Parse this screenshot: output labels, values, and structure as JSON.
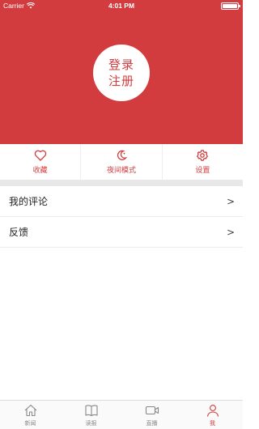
{
  "status_bar": {
    "carrier": "Carrier",
    "time": "4:01 PM"
  },
  "profile": {
    "login_line1": "登录",
    "login_line2": "注册"
  },
  "quick_actions": [
    {
      "label": "收藏",
      "icon": "heart-icon"
    },
    {
      "label": "夜间模式",
      "icon": "moon-icon"
    },
    {
      "label": "设置",
      "icon": "gear-icon"
    }
  ],
  "menu": [
    {
      "label": "我的评论",
      "chevron": ">"
    },
    {
      "label": "反馈",
      "chevron": ">"
    }
  ],
  "tabs": [
    {
      "label": "新闻",
      "icon": "home-icon",
      "active": false
    },
    {
      "label": "读报",
      "icon": "book-icon",
      "active": false
    },
    {
      "label": "直播",
      "icon": "video-camera-icon",
      "active": false
    },
    {
      "label": "我",
      "icon": "person-icon",
      "active": true
    }
  ],
  "colors": {
    "accent": "#d33c3e",
    "tab_inactive": "#888888"
  }
}
